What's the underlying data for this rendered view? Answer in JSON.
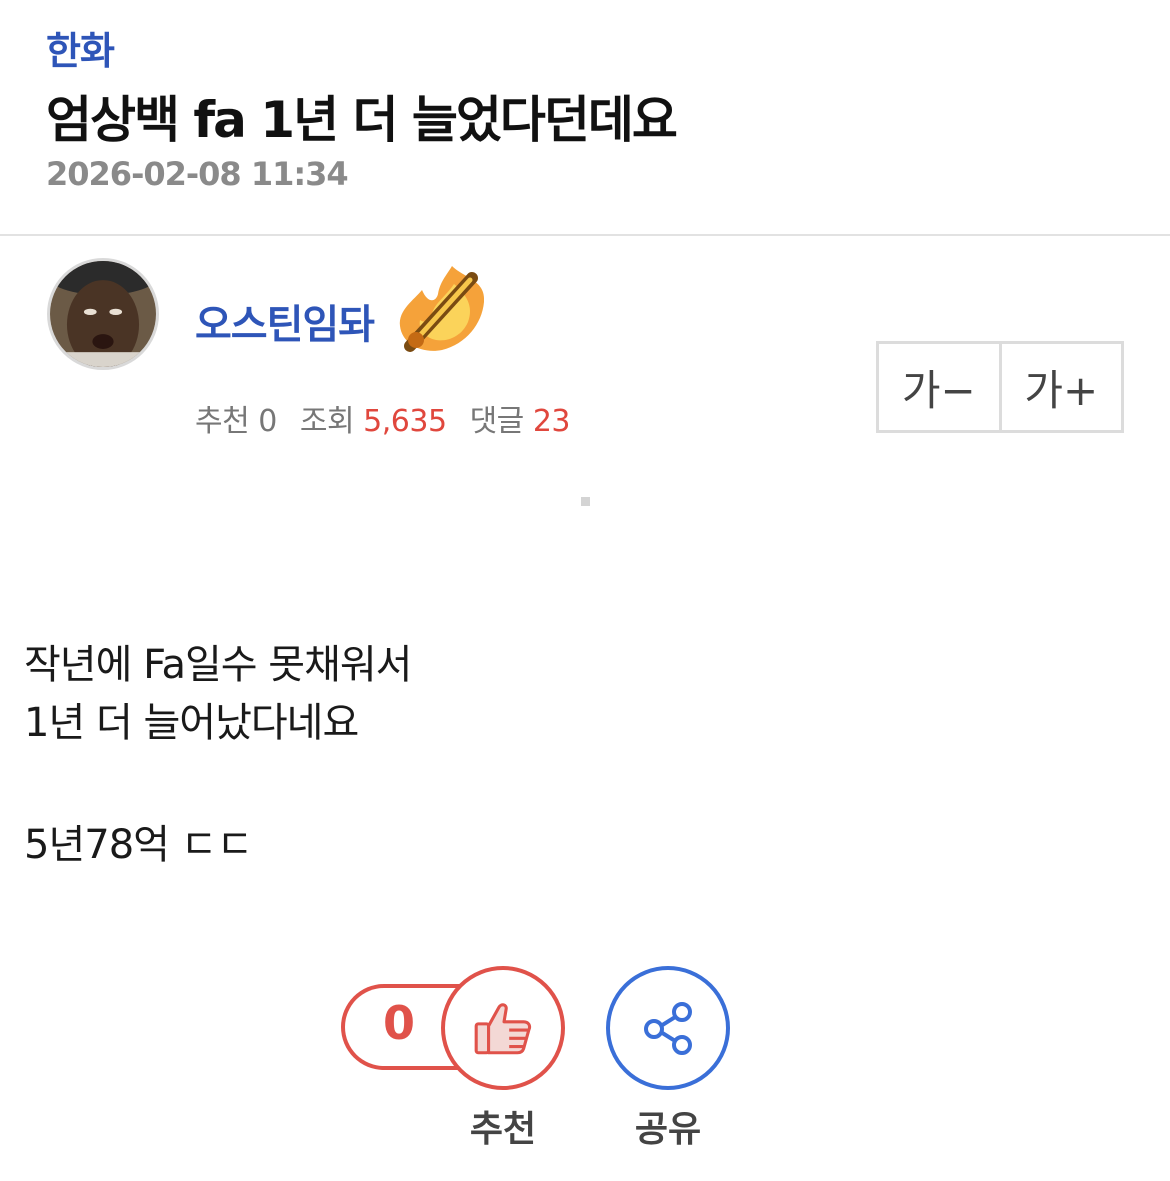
{
  "post": {
    "category": "한화",
    "title": "엄상백 fa 1년 더 늘었다던데요",
    "date": "2026-02-08 11:34"
  },
  "author": {
    "nickname": "오스틴임돠",
    "avatar_icon": "user-avatar-photo",
    "badge_icon": "flame-sword-badge-icon"
  },
  "stats": {
    "recommend_label": "추천",
    "recommend_count": "0",
    "views_label": "조회",
    "views_count": "5,635",
    "comments_label": "댓글",
    "comments_count": "23"
  },
  "font_controls": {
    "decrease": "가−",
    "increase": "가+"
  },
  "body": {
    "lines": [
      "작년에 Fa일수 못채워서",
      "1년 더 늘어났다네요",
      "",
      "5년78억 ㄷㄷ"
    ]
  },
  "actions": {
    "recommend_count": "0",
    "recommend_label": "추천",
    "share_label": "공유"
  },
  "colors": {
    "link_blue": "#2e55b8",
    "accent_red": "#e0524a",
    "share_blue": "#3a6fd8"
  }
}
